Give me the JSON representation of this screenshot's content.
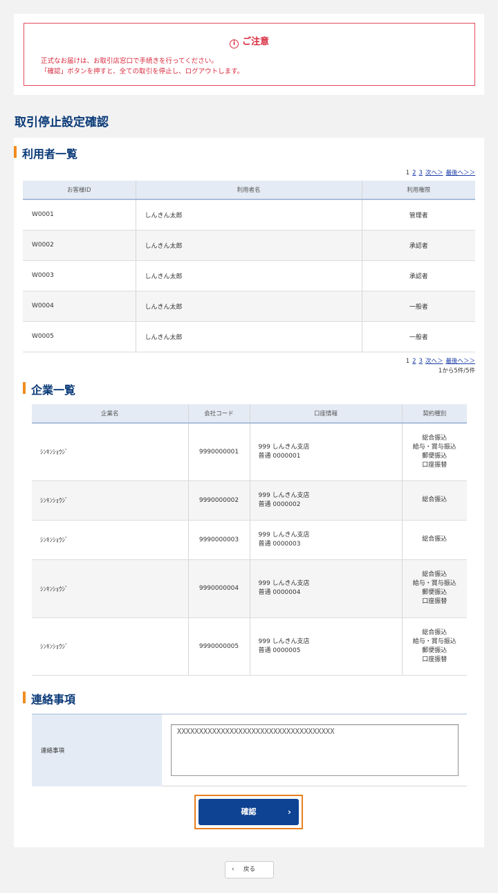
{
  "notice": {
    "title": "ご注意",
    "line1": "正式なお届けは、お取引店窓口で手続きを行ってください。",
    "line2": "「確認」ボタンを押すと、全ての取引を停止し、ログアウトします。"
  },
  "page_title": "取引停止設定確認",
  "users": {
    "heading": "利用者一覧",
    "pager": [
      "1",
      "2",
      "3",
      "次へ＞",
      "最後へ＞＞"
    ],
    "range_text": "1から5件/5件",
    "columns": [
      "お客様ID",
      "利用者名",
      "利用権限"
    ],
    "rows": [
      {
        "id": "W0001",
        "name": "しんきん太郎",
        "role": "管理者"
      },
      {
        "id": "W0002",
        "name": "しんきん太郎",
        "role": "承認者"
      },
      {
        "id": "W0003",
        "name": "しんきん太郎",
        "role": "承認者"
      },
      {
        "id": "W0004",
        "name": "しんきん太郎",
        "role": "一般者"
      },
      {
        "id": "W0005",
        "name": "しんきん太郎",
        "role": "一般者"
      }
    ]
  },
  "companies": {
    "heading": "企業一覧",
    "columns": [
      "企業名",
      "会社コード",
      "口座情報",
      "契約種別"
    ],
    "rows": [
      {
        "name": "ｼﾝｷﾝｼｮｳｼﾞ",
        "code": "9990000001",
        "branch": "999 しんきん支店",
        "account": "普通 0000001",
        "kinds": [
          "総合振込",
          "給与・賞与振込",
          "郵便振込",
          "口座振替"
        ]
      },
      {
        "name": "ｼﾝｷﾝｼｮｳｼﾞ",
        "code": "9990000002",
        "branch": "999 しんきん支店",
        "account": "普通 0000002",
        "kinds": [
          "総合振込"
        ]
      },
      {
        "name": "ｼﾝｷﾝｼｮｳｼﾞ",
        "code": "9990000003",
        "branch": "999 しんきん支店",
        "account": "普通 0000003",
        "kinds": [
          "総合振込"
        ]
      },
      {
        "name": "ｼﾝｷﾝｼｮｳｼﾞ",
        "code": "9990000004",
        "branch": "999 しんきん支店",
        "account": "普通 0000004",
        "kinds": [
          "総合振込",
          "給与・賞与振込",
          "郵便振込",
          "口座振替"
        ]
      },
      {
        "name": "ｼﾝｷﾝｼｮｳｼﾞ",
        "code": "9990000005",
        "branch": "999 しんきん支店",
        "account": "普通 0000005",
        "kinds": [
          "総合振込",
          "給与・賞与振込",
          "郵便振込",
          "口座振替"
        ]
      }
    ]
  },
  "contact": {
    "heading": "連絡事項",
    "label": "連絡事項",
    "value": "XXXXXXXXXXXXXXXXXXXXXXXXXXXXXXXXXXXX"
  },
  "buttons": {
    "confirm": "確認",
    "back": "戻る"
  },
  "icons": {
    "info": "info-circle-icon",
    "chevron_right": "chevron-right-icon",
    "chevron_left": "chevron-left-icon"
  }
}
